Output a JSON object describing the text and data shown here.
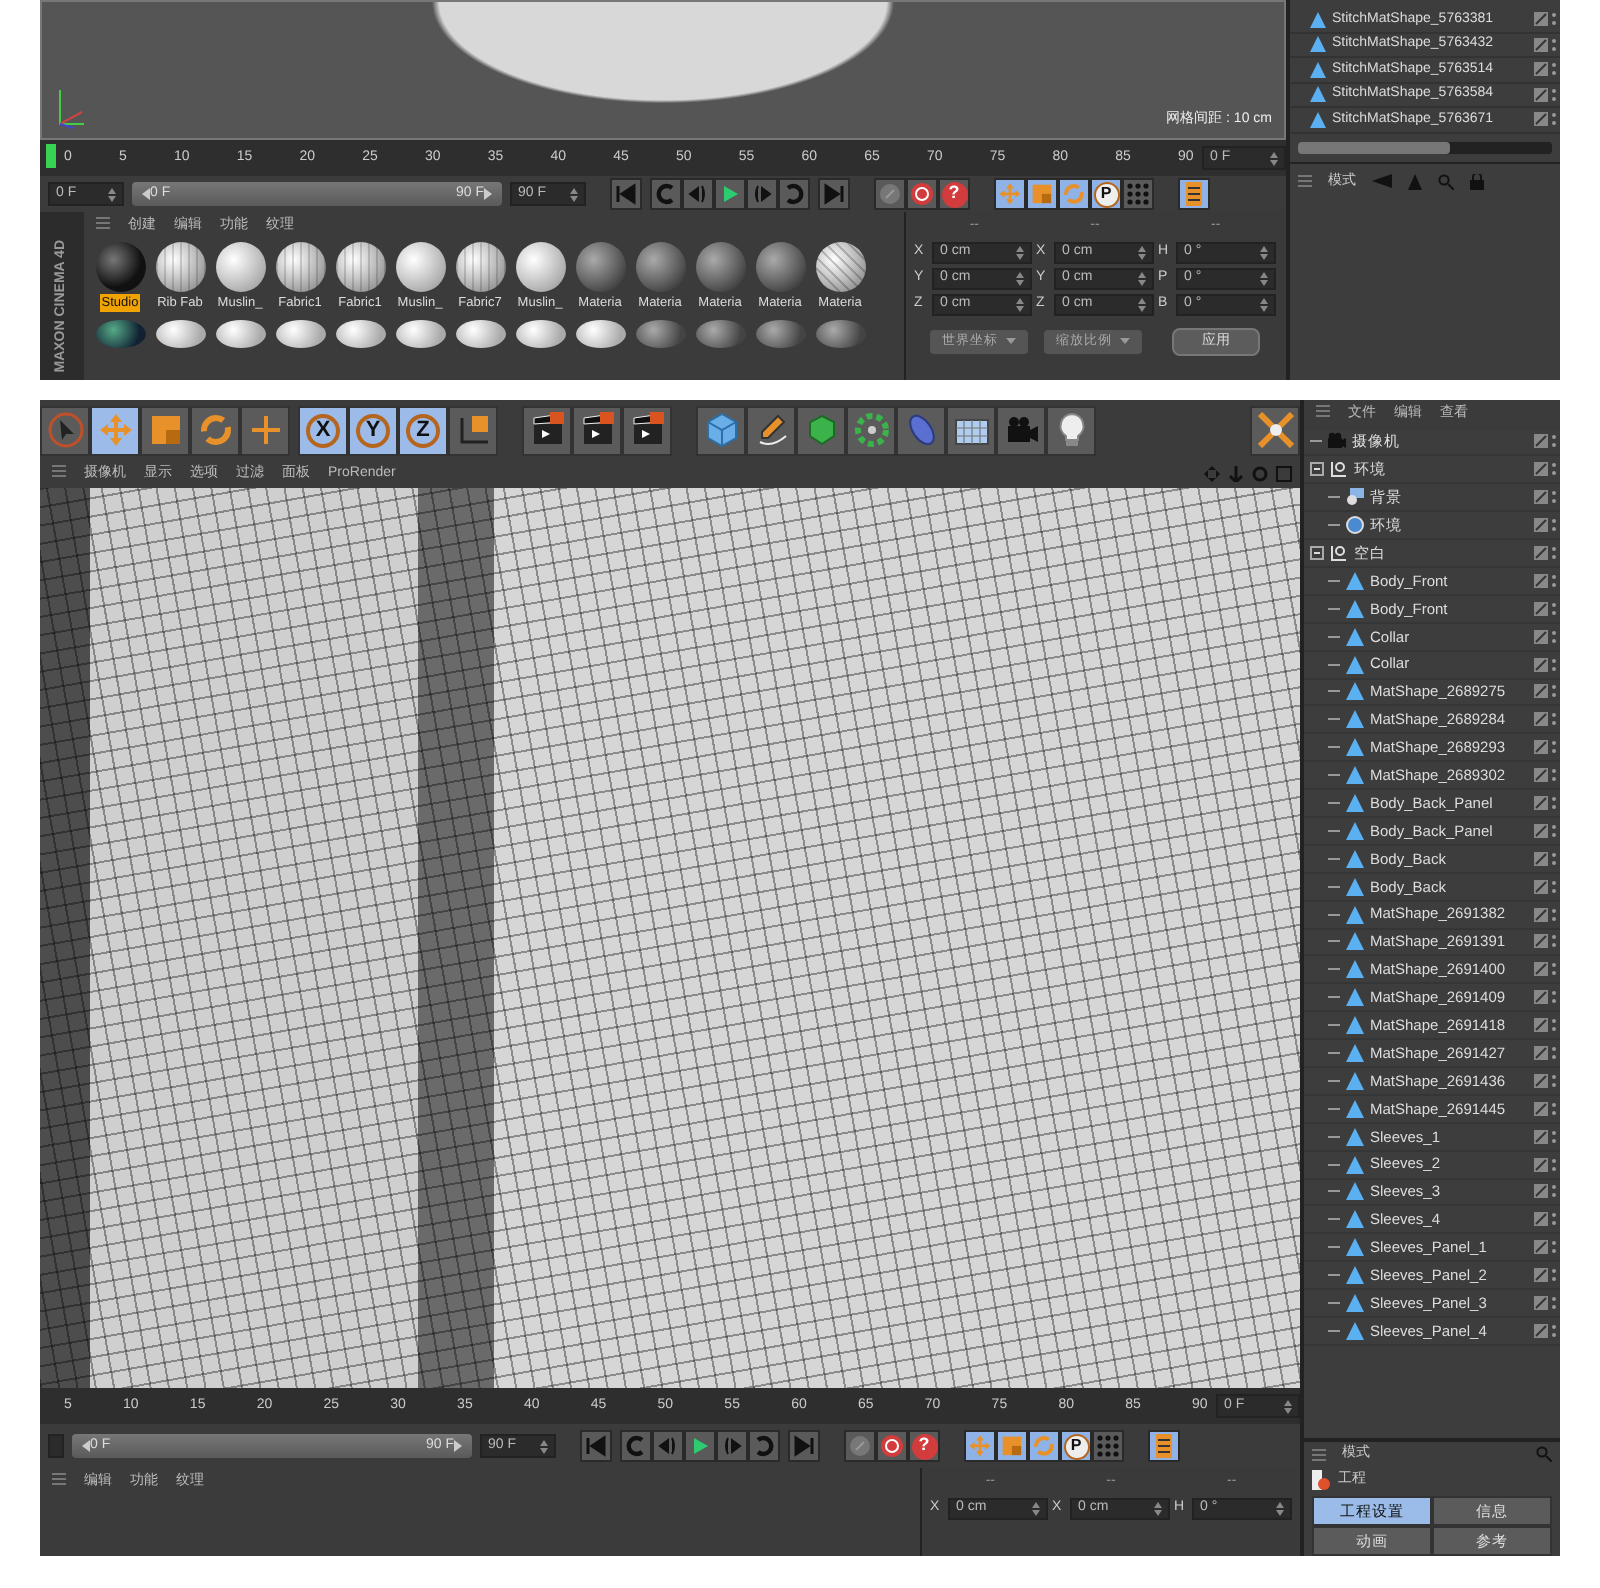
{
  "top_screen": {
    "viewport": {
      "grid_spacing": "网格间距 : 10 cm"
    },
    "timeline": {
      "ticks": [
        "0",
        "5",
        "10",
        "15",
        "20",
        "25",
        "30",
        "35",
        "40",
        "45",
        "50",
        "55",
        "60",
        "65",
        "70",
        "75",
        "80",
        "85",
        "90"
      ],
      "level": 0,
      "frame_field": "0 F"
    },
    "transport": {
      "start_field": "0 F",
      "range_start": "0 F",
      "range_end": "90 F",
      "level": 1,
      "end_field": "90 F",
      "help_label": "?",
      "param_label": "P"
    },
    "materials": {
      "menu": [
        "创建",
        "编辑",
        "功能",
        "纹理"
      ],
      "swatches": [
        {
          "label": "Studio",
          "kind": "dark",
          "selected": true
        },
        {
          "label": "Rib Fab",
          "kind": "fabric",
          "selected": false
        },
        {
          "label": "Muslin_",
          "kind": "light",
          "selected": false
        },
        {
          "label": "Fabric1",
          "kind": "fabric",
          "selected": false
        },
        {
          "label": "Fabric1",
          "kind": "fabric",
          "selected": false
        },
        {
          "label": "Muslin_",
          "kind": "light",
          "selected": false
        },
        {
          "label": "Fabric7",
          "kind": "fabric",
          "selected": false
        },
        {
          "label": "Muslin_",
          "kind": "light",
          "selected": false
        },
        {
          "label": "Materia",
          "kind": "grey",
          "selected": false
        },
        {
          "label": "Materia",
          "kind": "grey",
          "selected": false
        },
        {
          "label": "Materia",
          "kind": "grey",
          "selected": false
        },
        {
          "label": "Materia",
          "kind": "grey",
          "selected": false
        },
        {
          "label": "Materia",
          "kind": "stripe",
          "selected": false
        }
      ],
      "second_row": [
        {
          "kind": "green"
        },
        {
          "kind": "light"
        },
        {
          "kind": "light"
        },
        {
          "kind": "light"
        },
        {
          "kind": "light"
        },
        {
          "kind": "light"
        },
        {
          "kind": "light"
        },
        {
          "kind": "light"
        },
        {
          "kind": "light"
        },
        {
          "kind": "grey"
        },
        {
          "kind": "grey"
        },
        {
          "kind": "grey"
        },
        {
          "kind": "grey"
        }
      ]
    },
    "logo": {
      "brand": "MAXON",
      "product": "CINEMA 4D"
    },
    "coordinates": {
      "headers": [
        "--",
        "--",
        "--"
      ],
      "rows": [
        [
          "X",
          "0 cm",
          "X",
          "0 cm",
          "H",
          "0 °"
        ],
        [
          "Y",
          "0 cm",
          "Y",
          "0 cm",
          "P",
          "0 °"
        ],
        [
          "Z",
          "0 cm",
          "Z",
          "0 cm",
          "B",
          "0 °"
        ]
      ],
      "dropdowns": [
        "世界坐标",
        "缩放比例"
      ],
      "apply": "应用"
    },
    "objects": [
      "StitchMatShape_5763381",
      "StitchMatShape_5763432",
      "StitchMatShape_5763514",
      "StitchMatShape_5763584",
      "StitchMatShape_5763671"
    ],
    "attributes": {
      "mode": "模式"
    }
  },
  "bottom_screen": {
    "toolbar": {
      "axis_labels": [
        "X",
        "Y",
        "Z"
      ]
    },
    "object_menu": [
      "文件",
      "编辑",
      "查看"
    ],
    "viewport_menu": [
      "摄像机",
      "显示",
      "选项",
      "过滤",
      "面板",
      "ProRender"
    ],
    "timeline": {
      "ticks": [
        "5",
        "10",
        "15",
        "20",
        "25",
        "30",
        "35",
        "40",
        "45",
        "50",
        "55",
        "60",
        "65",
        "70",
        "75",
        "80",
        "85",
        "90"
      ],
      "frame_field": "0 F"
    },
    "transport": {
      "range_start": "0 F",
      "range_end": "90 F",
      "level": 1,
      "end_field": "90 F",
      "help_label": "?",
      "param_label": "P"
    },
    "material_menu": [
      "编辑",
      "功能",
      "纹理"
    ],
    "coordinates": {
      "headers": [
        "--",
        "--",
        "--"
      ],
      "rows": [
        [
          "X",
          "0 cm",
          "X",
          "0 cm",
          "H",
          "0 °"
        ]
      ]
    },
    "tree": [
      {
        "name": "摄像机",
        "kind": "camera"
      },
      {
        "name": "环境",
        "kind": "null",
        "children": [
          {
            "name": "背景",
            "kind": "background"
          },
          {
            "name": "环境",
            "kind": "sky"
          }
        ]
      },
      {
        "name": "空白",
        "kind": "null",
        "children": [
          {
            "name": "Body_Front",
            "kind": "mesh"
          },
          {
            "name": "Body_Front",
            "kind": "mesh"
          },
          {
            "name": "Collar",
            "kind": "mesh"
          },
          {
            "name": "Collar",
            "kind": "mesh"
          },
          {
            "name": "MatShape_2689275",
            "kind": "mesh"
          },
          {
            "name": "MatShape_2689284",
            "kind": "mesh"
          },
          {
            "name": "MatShape_2689293",
            "kind": "mesh"
          },
          {
            "name": "MatShape_2689302",
            "kind": "mesh"
          },
          {
            "name": "Body_Back_Panel",
            "kind": "mesh"
          },
          {
            "name": "Body_Back_Panel",
            "kind": "mesh"
          },
          {
            "name": "Body_Back",
            "kind": "mesh"
          },
          {
            "name": "Body_Back",
            "kind": "mesh"
          },
          {
            "name": "MatShape_2691382",
            "kind": "mesh"
          },
          {
            "name": "MatShape_2691391",
            "kind": "mesh"
          },
          {
            "name": "MatShape_2691400",
            "kind": "mesh"
          },
          {
            "name": "MatShape_2691409",
            "kind": "mesh"
          },
          {
            "name": "MatShape_2691418",
            "kind": "mesh"
          },
          {
            "name": "MatShape_2691427",
            "kind": "mesh"
          },
          {
            "name": "MatShape_2691436",
            "kind": "mesh"
          },
          {
            "name": "MatShape_2691445",
            "kind": "mesh"
          },
          {
            "name": "Sleeves_1",
            "kind": "mesh"
          },
          {
            "name": "Sleeves_2",
            "kind": "mesh"
          },
          {
            "name": "Sleeves_3",
            "kind": "mesh"
          },
          {
            "name": "Sleeves_4",
            "kind": "mesh"
          },
          {
            "name": "Sleeves_Panel_1",
            "kind": "mesh"
          },
          {
            "name": "Sleeves_Panel_2",
            "kind": "mesh"
          },
          {
            "name": "Sleeves_Panel_3",
            "kind": "mesh"
          },
          {
            "name": "Sleeves_Panel_4",
            "kind": "mesh"
          }
        ]
      }
    ],
    "attributes": {
      "mode": "模式",
      "title": "工程",
      "tabs": [
        {
          "label": "工程设置",
          "selected": true
        },
        {
          "label": "信息",
          "selected": false
        },
        {
          "label": "动画",
          "selected": false
        },
        {
          "label": "参考",
          "selected": false
        }
      ]
    }
  }
}
